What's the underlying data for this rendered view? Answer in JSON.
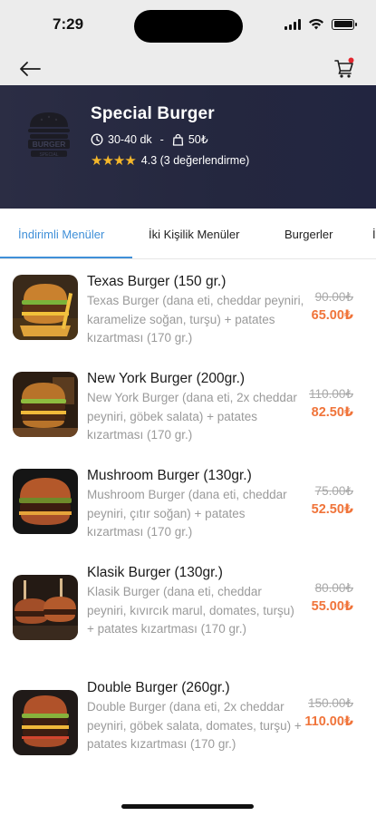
{
  "status_bar": {
    "time": "7:29"
  },
  "nav": {
    "back_icon": "arrow-left-icon",
    "cart_icon": "cart-icon"
  },
  "store": {
    "name": "Special Burger",
    "delivery_time": "30-40 dk",
    "separator": "-",
    "min_order": "50₺",
    "stars": "★★★★",
    "rating_text": "4.3 (3 değerlendirme)",
    "logo_text_top": "BURGER",
    "logo_text_bottom": "SPECIAL"
  },
  "colors": {
    "accent": "#3f8fd8",
    "header_bg": "#24273f",
    "price": "#f0743a",
    "star": "#f5b72a"
  },
  "tabs": [
    {
      "label": "İndirimli Menüler",
      "active": true
    },
    {
      "label": "İki Kişilik Menüler",
      "active": false
    },
    {
      "label": "Burgerler",
      "active": false
    },
    {
      "label": "İ",
      "active": false
    }
  ],
  "menu_items": [
    {
      "title": "Texas Burger (150 gr.)",
      "description": "Texas Burger (dana eti, cheddar peyniri, karamelize soğan, turşu) + patates kızartması (170 gr.)",
      "old_price": "90.00₺",
      "new_price": "65.00₺"
    },
    {
      "title": "New York Burger (200gr.)",
      "description": "New York Burger (dana eti, 2x cheddar peyniri, göbek salata) + patates kızartması (170 gr.)",
      "old_price": "110.00₺",
      "new_price": "82.50₺"
    },
    {
      "title": "Mushroom Burger (130gr.)",
      "description": "Mushroom Burger (dana eti, cheddar peyniri, çıtır soğan) + patates kızartması (170 gr.)",
      "old_price": "75.00₺",
      "new_price": "52.50₺"
    },
    {
      "title": "Klasik Burger (130gr.)",
      "description": "Klasik Burger (dana eti, cheddar peyniri, kıvırcık marul, domates, turşu) + patates kızartması (170 gr.)",
      "old_price": "80.00₺",
      "new_price": "55.00₺"
    },
    {
      "title": "Double Burger (260gr.)",
      "description": "Double Burger (dana eti, 2x cheddar peyniri, göbek salata, domates, turşu) + patates kızartması (170 gr.)",
      "old_price": "150.00₺",
      "new_price": "110.00₺"
    }
  ]
}
